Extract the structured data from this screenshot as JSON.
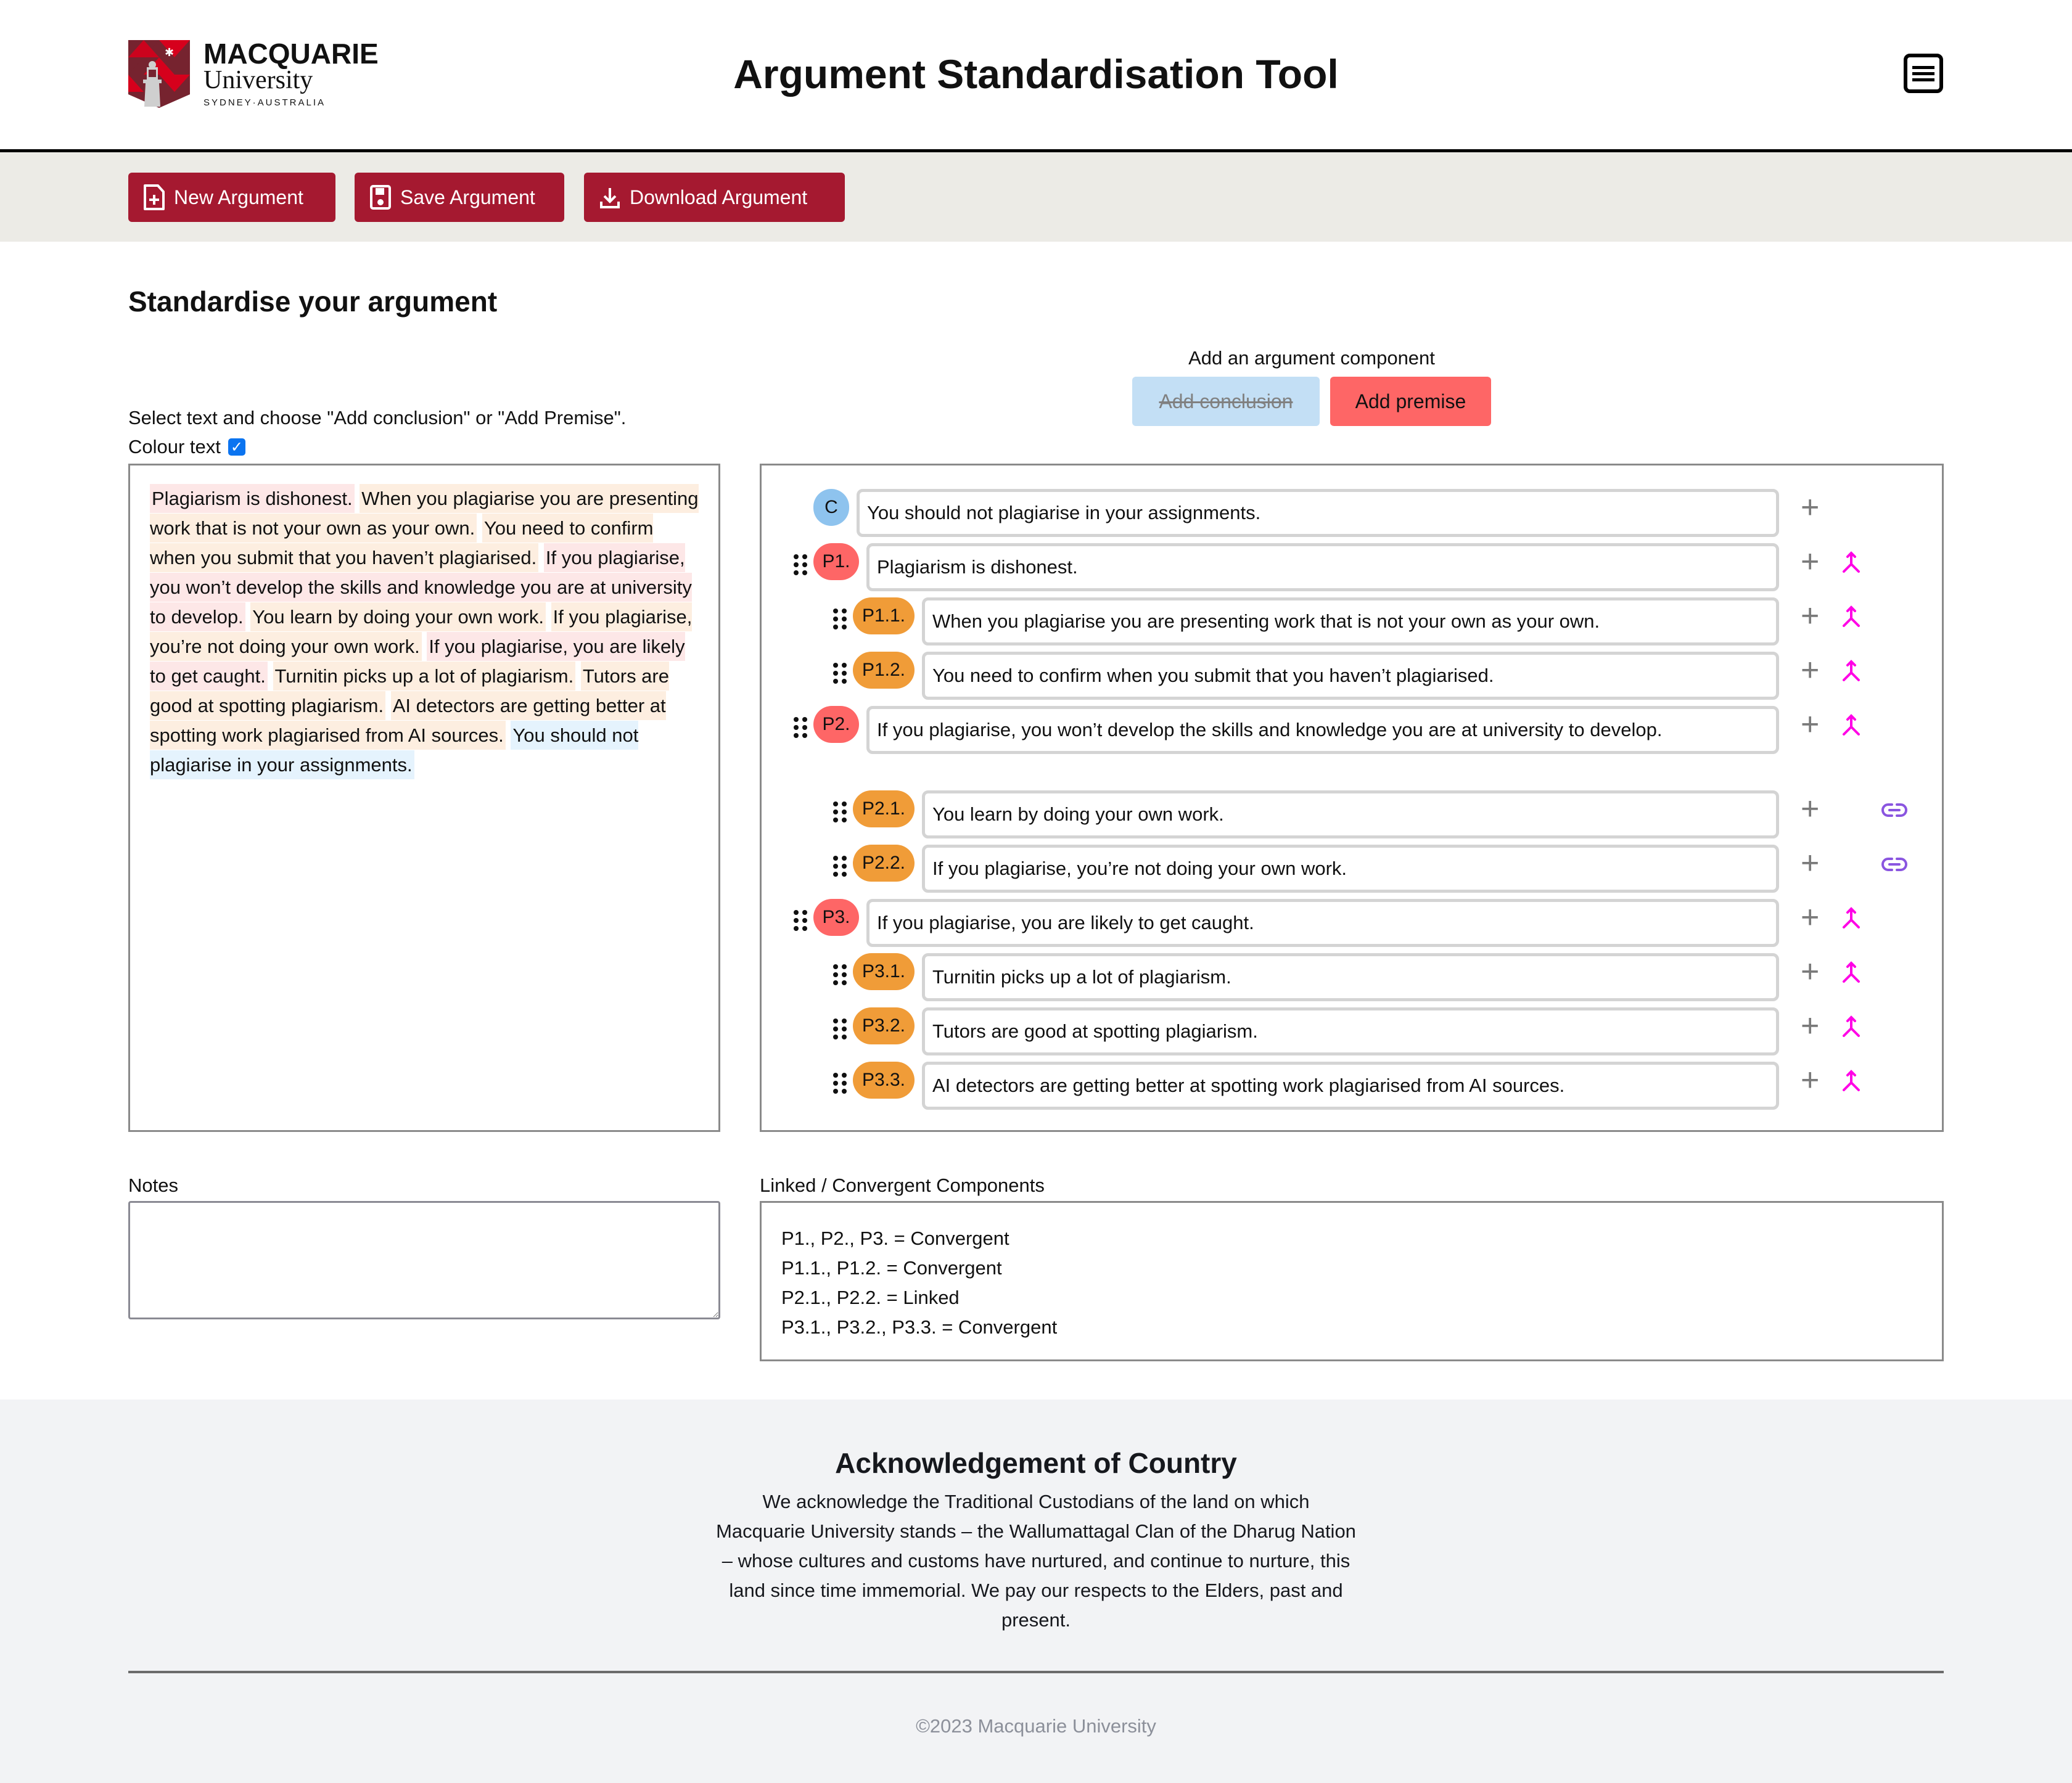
{
  "header": {
    "logo": {
      "name": "MACQUARIE",
      "sub": "University",
      "location": "SYDNEY·AUSTRALIA",
      "colors": {
        "dark": "#76232f",
        "red": "#d6001c",
        "lighthouse": "#c8c8c8"
      }
    },
    "title": "Argument Standardisation Tool",
    "menu_icon": "hamburger-menu-icon"
  },
  "toolbar": {
    "accent": "#a51930",
    "buttons": [
      {
        "label": "New Argument",
        "icon": "file-plus-icon"
      },
      {
        "label": "Save Argument",
        "icon": "save-icon"
      },
      {
        "label": "Download Argument",
        "icon": "download-icon"
      }
    ]
  },
  "main": {
    "section_title": "Standardise your argument",
    "add_component": {
      "label": "Add an argument component",
      "conclusion_button": {
        "label": "Add conclusion",
        "disabled": true,
        "color": "#c3dff5"
      },
      "premise_button": {
        "label": "Add premise",
        "color": "#fe6666"
      }
    },
    "instructions": "Select text and choose \"Add conclusion\" or \"Add Premise\".",
    "colour_text": {
      "label": "Colour text",
      "checked": true
    },
    "source_text": [
      {
        "text": "Plagiarism is dishonest.",
        "type": "premise"
      },
      {
        "text": "When you plagiarise you are presenting work that is not your own as your own.",
        "type": "sub"
      },
      {
        "text": "You need to confirm when you submit that you haven’t plagiarised.",
        "type": "sub"
      },
      {
        "text": "If you plagiarise, you won’t develop the skills and knowledge you are at university to develop.",
        "type": "premise"
      },
      {
        "text": "You learn by doing your own work.",
        "type": "sub"
      },
      {
        "text": "If you plagiarise, you’re not doing your own work.",
        "type": "sub"
      },
      {
        "text": "If you plagiarise, you are likely to get caught.",
        "type": "premise"
      },
      {
        "text": "Turnitin picks up a lot of plagiarism.",
        "type": "sub"
      },
      {
        "text": "Tutors are good at spotting plagiarism.",
        "type": "sub"
      },
      {
        "text": "AI detectors are getting better at spotting work plagiarised from AI sources.",
        "type": "sub"
      },
      {
        "text": "You should not plagiarise in your assignments.",
        "type": "conclusion"
      }
    ],
    "components": [
      {
        "badge": "C",
        "level": "conclusion",
        "text": "You should not plagiarise in your assignments.",
        "relation": null
      },
      {
        "badge": "P1.",
        "level": "premise",
        "text": "Plagiarism is dishonest.",
        "relation": "convergent"
      },
      {
        "badge": "P1.1.",
        "level": "sub",
        "text": "When you plagiarise you are presenting work that is not your own as your own.",
        "relation": "convergent"
      },
      {
        "badge": "P1.2.",
        "level": "sub",
        "text": "You need to confirm when you submit that you haven’t plagiarised.",
        "relation": "convergent"
      },
      {
        "badge": "P2.",
        "level": "premise",
        "text": "If you plagiarise, you won’t develop the skills and knowledge you are at university to develop.",
        "relation": "convergent"
      },
      {
        "badge": "P2.1.",
        "level": "sub",
        "text": "You learn by doing your own work.",
        "relation": "linked"
      },
      {
        "badge": "P2.2.",
        "level": "sub",
        "text": "If you plagiarise, you’re not doing your own work.",
        "relation": "linked"
      },
      {
        "badge": "P3.",
        "level": "premise",
        "text": "If you plagiarise, you are likely to get caught.",
        "relation": "convergent"
      },
      {
        "badge": "P3.1.",
        "level": "sub",
        "text": "Turnitin picks up a lot of plagiarism.",
        "relation": "convergent"
      },
      {
        "badge": "P3.2.",
        "level": "sub",
        "text": "Tutors are good at spotting plagiarism.",
        "relation": "convergent"
      },
      {
        "badge": "P3.3.",
        "level": "sub",
        "text": "AI detectors are getting better at spotting work plagiarised from AI sources.",
        "relation": "convergent"
      }
    ],
    "colors": {
      "conclusion": "#8ec3ee",
      "premise": "#fe6666",
      "sub": "#f09c38",
      "convergent_icon": "#ff00e6",
      "linked_icon": "#8a55e0",
      "highlight_premise": "#fde7e7",
      "highlight_sub": "#fdeee0",
      "highlight_conclusion": "#e5f3fd"
    },
    "notes": {
      "label": "Notes",
      "value": ""
    },
    "linked_convergent": {
      "label": "Linked / Convergent Components",
      "lines": [
        "P1., P2., P3. = Convergent",
        "P1.1., P1.2. = Convergent",
        "P2.1., P2.2. = Linked",
        "P3.1., P3.2., P3.3. = Convergent"
      ]
    }
  },
  "footer": {
    "ack_title": "Acknowledgement of Country",
    "ack_text": "We acknowledge the Traditional Custodians of the land on which Macquarie University stands – the Wallumattagal Clan of the Dharug Nation – whose cultures and customs have nurtured, and continue to nurture, this land since time immemorial. We pay our respects to the Elders, past and present.",
    "copyright": "©2023 Macquarie University"
  }
}
